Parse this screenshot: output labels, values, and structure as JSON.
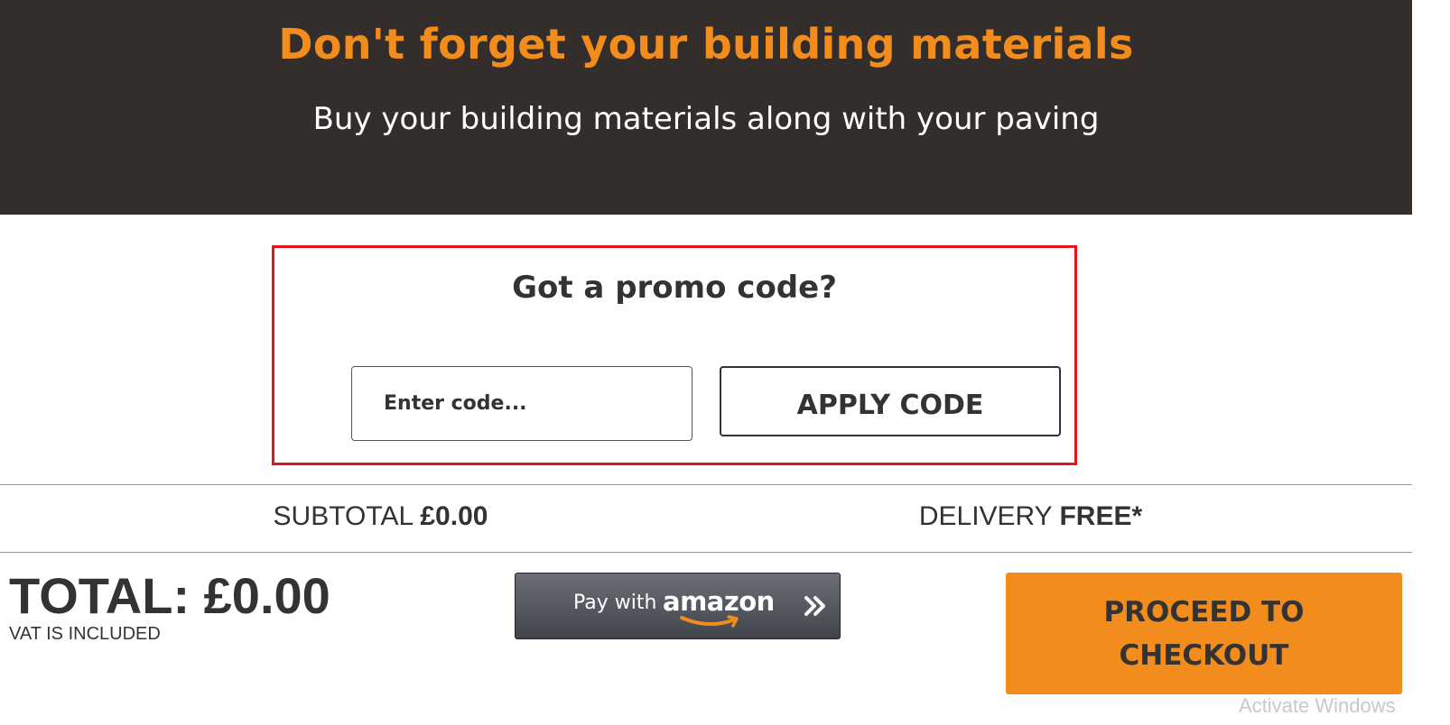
{
  "banner": {
    "title": "Don't forget your building materials",
    "subtitle": "Buy your building materials along with your paving"
  },
  "promo": {
    "title": "Got a promo code?",
    "input_placeholder": "Enter code...",
    "apply_label": "APPLY CODE"
  },
  "summary": {
    "subtotal_label": "SUBTOTAL",
    "subtotal_value": "£0.00",
    "delivery_label": "DELIVERY",
    "delivery_value": "FREE*"
  },
  "total": {
    "text": "TOTAL: £0.00",
    "vat_note": "VAT IS INCLUDED"
  },
  "amazon": {
    "pay_text": "Pay with",
    "brand": "amazon",
    "icon": "double-chevron-right-icon"
  },
  "checkout": {
    "label_line1": "PROCEED TO",
    "label_line2": "CHECKOUT"
  },
  "os_watermark": "Activate Windows",
  "colors": {
    "accent": "#f28c1c",
    "banner_bg": "#332e2b",
    "promo_border": "#e8141c",
    "text": "#333333"
  }
}
